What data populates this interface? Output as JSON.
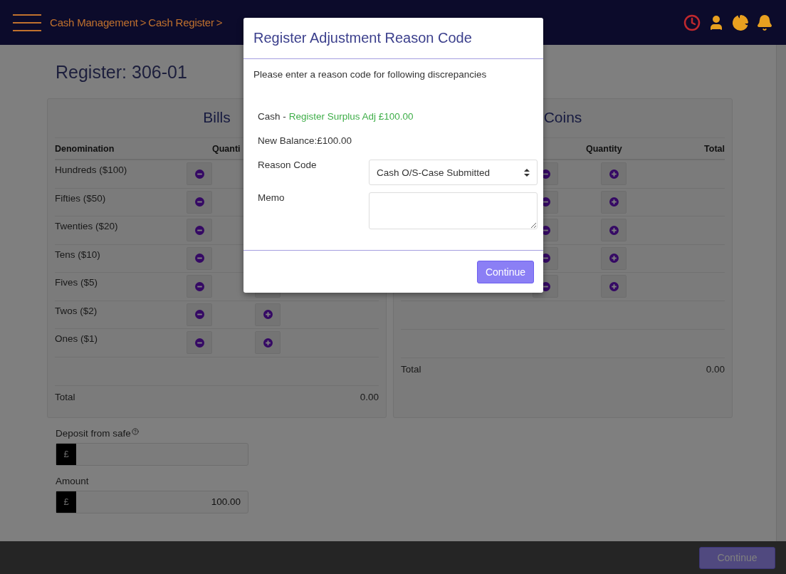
{
  "header": {
    "breadcrumb": [
      "Cash Management",
      ">",
      "Cash Register",
      ">"
    ]
  },
  "page": {
    "title": "Register: 306-01"
  },
  "bills": {
    "title": "Bills",
    "columns": [
      "Denomination",
      "Quanti"
    ],
    "rows": [
      {
        "kind": "counter",
        "label": "Hundreds ($100)"
      },
      {
        "kind": "counter",
        "label": "Fifties ($50)"
      },
      {
        "kind": "counter",
        "label": "Twenties ($20)"
      },
      {
        "kind": "counter",
        "label": "Tens ($10)"
      },
      {
        "kind": "counter",
        "label": "Fives ($5)"
      },
      {
        "kind": "counter",
        "label": "Twos ($2)"
      },
      {
        "kind": "counter",
        "label": "Ones ($1)"
      },
      {
        "kind": "empty"
      }
    ],
    "total": {
      "label": "Total",
      "value": "0.00"
    }
  },
  "coins": {
    "title": "Coins",
    "columns": [
      "Quantity",
      "Total"
    ],
    "rows": [
      {
        "kind": "counter"
      },
      {
        "kind": "counter"
      },
      {
        "kind": "counter"
      },
      {
        "kind": "counter"
      },
      {
        "kind": "counter"
      },
      {
        "kind": "empty"
      },
      {
        "kind": "empty"
      }
    ],
    "total": {
      "label": "Total",
      "value": "0.00"
    }
  },
  "deposit": {
    "label": "Deposit from safe",
    "currency": "£"
  },
  "amount": {
    "label": "Amount",
    "currency": "£",
    "value": "100.00"
  },
  "footer": {
    "button": "Continue"
  },
  "modal": {
    "title": "Register Adjustment Reason Code",
    "intro": "Please enter a reason code for following discrepancies",
    "discrepancy": {
      "label": "Cash -",
      "detail": "Register Surplus Adj £100.00"
    },
    "balance": "New Balance:£100.00",
    "reason": {
      "label": "Reason Code",
      "value": "Cash O/S-Case Submitted"
    },
    "memo": {
      "label": "Memo"
    },
    "button": "Continue"
  }
}
